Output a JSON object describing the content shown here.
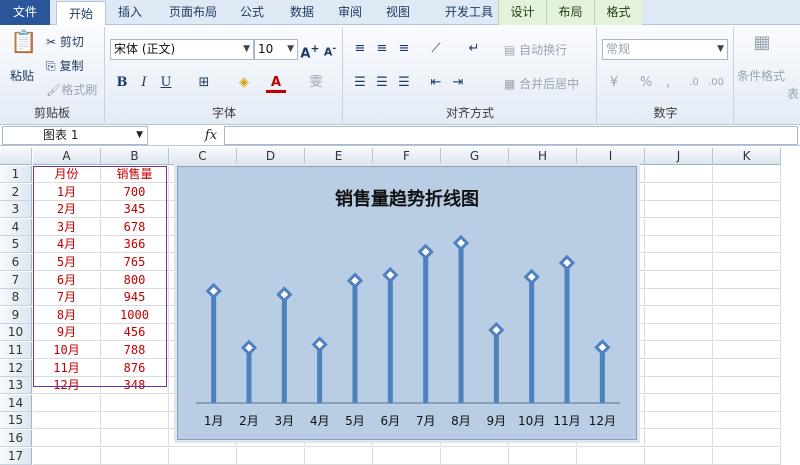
{
  "tabs": [
    "文件",
    "开始",
    "插入",
    "页面布局",
    "公式",
    "数据",
    "审阅",
    "视图",
    "开发工具",
    "设计",
    "布局",
    "格式"
  ],
  "ribbon": {
    "clipboard": {
      "paste": "粘贴",
      "cut": "剪切",
      "copy": "复制",
      "format_painter": "格式刷",
      "label": "剪贴板"
    },
    "font": {
      "name": "宋体 (正文)",
      "size": "10",
      "label": "字体",
      "bold": "B",
      "italic": "I",
      "underline": "U"
    },
    "align": {
      "wrap": "自动换行",
      "merge": "合并后居中",
      "label": "对齐方式"
    },
    "number": {
      "format": "常规",
      "label": "数字",
      "percent": "%",
      "comma": ","
    },
    "styles": {
      "cond_format": "条件格式",
      "table": "表"
    }
  },
  "formula_bar": {
    "name_box": "图表 1",
    "fx": "fx",
    "value": ""
  },
  "sheet": {
    "columns": [
      "A",
      "B",
      "C",
      "D",
      "E",
      "F",
      "G",
      "H",
      "I",
      "J",
      "K"
    ],
    "rows": [
      "1",
      "2",
      "3",
      "4",
      "5",
      "6",
      "7",
      "8",
      "9",
      "10",
      "11",
      "12",
      "13",
      "14",
      "15",
      "16",
      "17"
    ],
    "header": [
      "月份",
      "销售量"
    ],
    "data": [
      [
        "1月",
        "700"
      ],
      [
        "2月",
        "345"
      ],
      [
        "3月",
        "678"
      ],
      [
        "4月",
        "366"
      ],
      [
        "5月",
        "765"
      ],
      [
        "6月",
        "800"
      ],
      [
        "7月",
        "945"
      ],
      [
        "8月",
        "1000"
      ],
      [
        "9月",
        "456"
      ],
      [
        "10月",
        "788"
      ],
      [
        "11月",
        "876"
      ],
      [
        "12月",
        "348"
      ]
    ]
  },
  "colors": {
    "accent": "#2a5699",
    "cell_text": "#c00000",
    "series": "#4f81bd",
    "chart_bg": "#b9cde5"
  },
  "chart_data": {
    "type": "line",
    "title": "销售量趋势折线图",
    "categories": [
      "1月",
      "2月",
      "3月",
      "4月",
      "5月",
      "6月",
      "7月",
      "8月",
      "9月",
      "10月",
      "11月",
      "12月"
    ],
    "series": [
      {
        "values": [
          700,
          345,
          678,
          366,
          765,
          800,
          945,
          1000,
          456,
          788,
          876,
          348
        ]
      }
    ],
    "ylim": [
      0,
      1100
    ],
    "grid": false,
    "legend": "none",
    "marker": "diamond",
    "drop_lines": true
  }
}
